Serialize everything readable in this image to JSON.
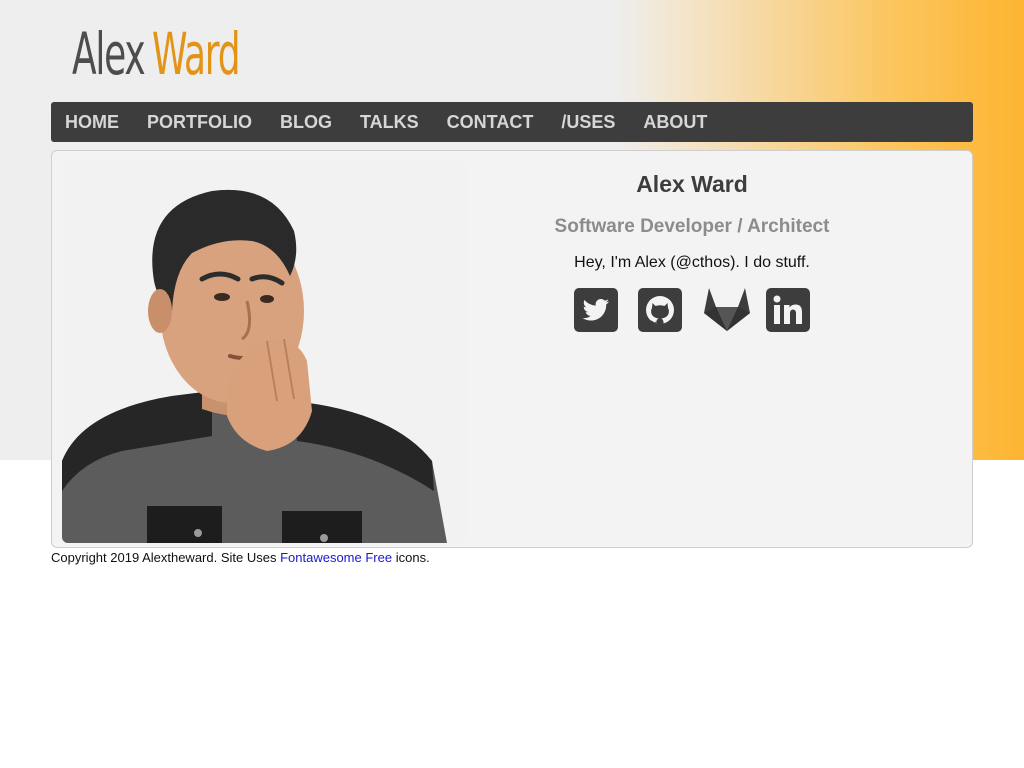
{
  "logo": {
    "first": "Alex",
    "last": "Ward"
  },
  "nav": [
    {
      "label": "HOME"
    },
    {
      "label": "PORTFOLIO"
    },
    {
      "label": "BLOG"
    },
    {
      "label": "TALKS"
    },
    {
      "label": "CONTACT"
    },
    {
      "label": "/USES"
    },
    {
      "label": "ABOUT"
    }
  ],
  "profile": {
    "name": "Alex Ward",
    "role": "Software Developer / Architect",
    "bio": "Hey, I'm Alex (@cthos). I do stuff.",
    "photo_icon": "portrait-photo",
    "socials": [
      {
        "icon": "twitter-icon"
      },
      {
        "icon": "github-icon"
      },
      {
        "icon": "gitlab-icon"
      },
      {
        "icon": "linkedin-icon"
      }
    ]
  },
  "footer": {
    "text": "Copyright 2019 Alextheward. Site Uses",
    "link": "Fontawesome Free",
    "suffix": "icons."
  },
  "colors": {
    "nav_bg": "#3d3d3d",
    "accent": "#e39417",
    "gradient_end": "#fdb531",
    "card_bg": "#f3f3f3",
    "link": "#1a1acf"
  }
}
